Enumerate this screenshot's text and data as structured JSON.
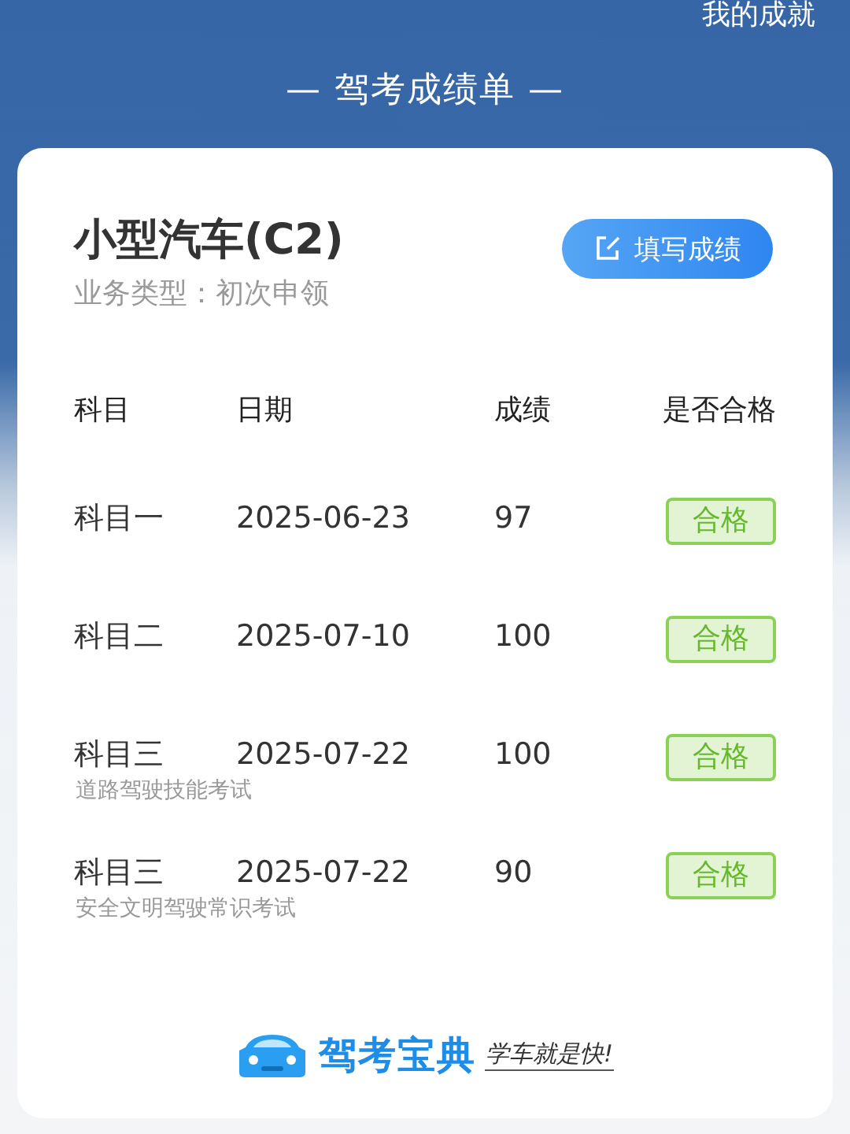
{
  "top_link": "我的成就",
  "title": "— 驾考成绩单 —",
  "card": {
    "vehicle": "小型汽车(C2)",
    "business_type": "业务类型：初次申领",
    "fill_button": "填写成绩"
  },
  "table": {
    "columns": [
      "科目",
      "日期",
      "成绩",
      "是否合格"
    ],
    "rows": [
      {
        "subject": "科目一",
        "date": "2025-06-23",
        "score": "97",
        "result": "合格",
        "passed": true
      },
      {
        "subject": "科目二",
        "date": "2025-07-10",
        "score": "100",
        "result": "合格",
        "passed": true
      },
      {
        "subject": "科目三",
        "note": "道路驾驶技能考试",
        "date": "2025-07-22",
        "score": "100",
        "result": "合格",
        "passed": true
      },
      {
        "subject": "科目三",
        "note": "安全文明驾驶常识考试",
        "date": "2025-07-22",
        "score": "90",
        "result": "合格",
        "passed": true
      }
    ]
  },
  "footer": {
    "brand": "驾考宝典",
    "slogan": "学车就是快!"
  }
}
